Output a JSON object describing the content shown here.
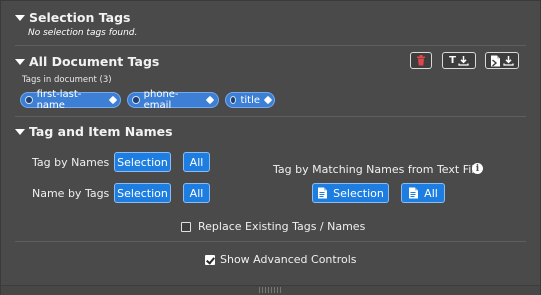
{
  "selection_tags": {
    "title": "Selection Tags",
    "empty_note": "No selection tags found."
  },
  "all_document_tags": {
    "title": "All Document Tags",
    "count_label": "Tags in document (3)",
    "tags": [
      "first-last-name",
      "phone-email",
      "title"
    ],
    "toolbar": {
      "text_button_label": "T"
    }
  },
  "tag_item_names": {
    "title": "Tag and Item Names",
    "tag_by_names_label": "Tag by Names",
    "name_by_tags_label": "Name by Tags",
    "selection_label": "Selection",
    "all_label": "All",
    "matching_file_label": "Tag by Matching Names from Text File",
    "file_selection_label": "Selection",
    "file_all_label": "All",
    "replace_label": "Replace Existing Tags / Names",
    "replace_checked": false,
    "advanced_label": "Show Advanced Controls",
    "advanced_checked": true
  },
  "colors": {
    "panel_bg": "#4a4a4a",
    "accent_blue": "#1e7de0",
    "chip_blue": "#3d7fd4",
    "delete_red": "#e0474c"
  }
}
